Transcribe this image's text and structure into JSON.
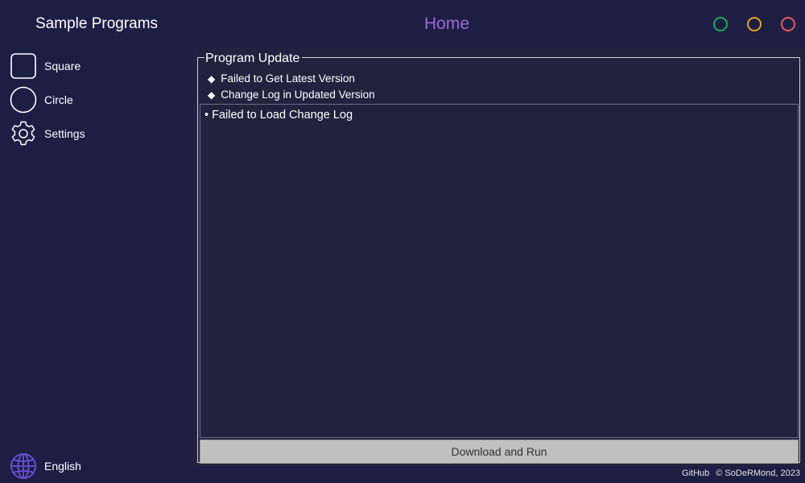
{
  "app": {
    "title": "Sample Programs",
    "page_title": "Home",
    "accent_color": "#9b6ad6"
  },
  "window_controls": {
    "minimize_color": "#1fa855",
    "maximize_color": "#e6a21a",
    "close_color": "#e25a5a"
  },
  "sidebar": {
    "items": [
      {
        "label": "Square",
        "icon": "square-icon"
      },
      {
        "label": "Circle",
        "icon": "circle-icon"
      },
      {
        "label": "Settings",
        "icon": "gear-icon"
      }
    ],
    "language": {
      "label": "English",
      "icon": "globe-icon",
      "icon_color": "#6a4fd8"
    }
  },
  "update": {
    "group_title": "Program Update",
    "latest_version": "Failed to Get Latest Version",
    "changelog_heading": "Change Log in Updated Version",
    "changelog_items": [
      "Failed to Load Change Log"
    ],
    "bullet": "•",
    "marker": "◆",
    "download_button": "Download and Run"
  },
  "footer": {
    "github": "GitHub",
    "copyright": "© SoDeRMond, 2023"
  }
}
